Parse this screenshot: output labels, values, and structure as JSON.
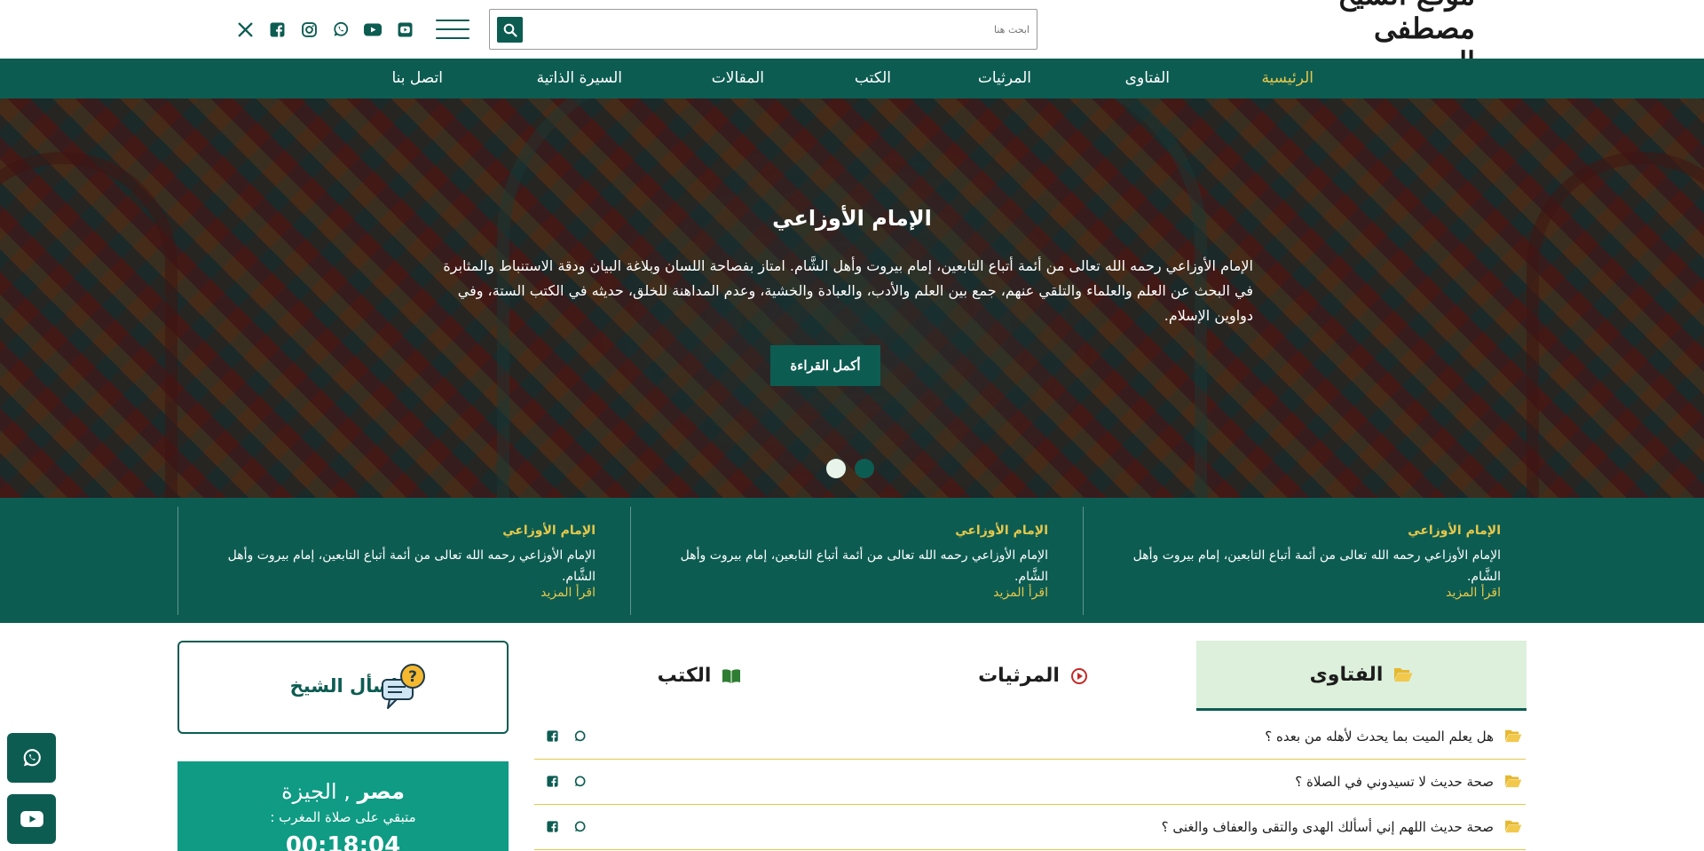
{
  "header": {
    "logo_text": "موقع الشيخ مصطفى العدوي",
    "search_placeholder": "ابحث هنا",
    "socials": [
      "x-icon",
      "facebook-icon",
      "instagram-icon",
      "whatsapp-icon",
      "youtube-icon",
      "youtube-square-icon"
    ]
  },
  "nav": {
    "items": [
      "الرئيسية",
      "الفتاوى",
      "المرثيات",
      "الكتب",
      "المقالات",
      "السيرة الذاتية",
      "اتصل بنا"
    ]
  },
  "hero": {
    "title": "الإمام الأوزاعي",
    "text": "الإمام الأوزاعي رحمه الله تعالى من أئمة أتباع التابعين، إمام بيروت وأهل الشَّام. امتاز بفصاحة اللسان وبلاغة البيان ودقة الاستنباط والمثابرة في البحث عن العلم والعلماء والتلقي عنهم، جمع بين العلم والأدب، والعبادة والخشية، وعدم المداهنة للخلق، حديثه في الكتب الستة، وفي دواوين الإسلام.",
    "button": "أكمل القراءة"
  },
  "cards": [
    {
      "title": "الإمام الأوزاعي",
      "text": "الإمام الأوزاعي رحمه الله تعالى من أئمة أتباع التابعين، إمام بيروت وأهل الشَّام.",
      "more": "اقرأ المزيد"
    },
    {
      "title": "الإمام الأوزاعي",
      "text": "الإمام الأوزاعي رحمه الله تعالى من أئمة أتباع التابعين، إمام بيروت وأهل الشَّام.",
      "more": "اقرأ المزيد"
    },
    {
      "title": "الإمام الأوزاعي",
      "text": "الإمام الأوزاعي رحمه الله تعالى من أئمة أتباع التابعين، إمام بيروت وأهل الشَّام.",
      "more": "اقرأ المزيد"
    }
  ],
  "tabs": [
    "الفتاوى",
    "المرثيات",
    "الكتب"
  ],
  "fatwas": [
    "هل يعلم الميت بما يحدث لأهله من بعده ؟",
    "صحة حديث لا تسيدوني في الصلاة ؟",
    "صحة حديث اللهم إني أسألك الهدى والتقى والعفاف والغنى ؟"
  ],
  "ask": {
    "label": "اسأل الشيخ"
  },
  "prayer": {
    "country": "مصر",
    "city": "الجيزة",
    "remaining": "متبقي على صلاة المغرب :",
    "time": "00:18:04"
  },
  "colors": {
    "primary": "#0d5c52",
    "accent": "#e6c84a",
    "prayer_bg": "#0f9b84",
    "tab_active_bg": "#dcf0dc"
  }
}
